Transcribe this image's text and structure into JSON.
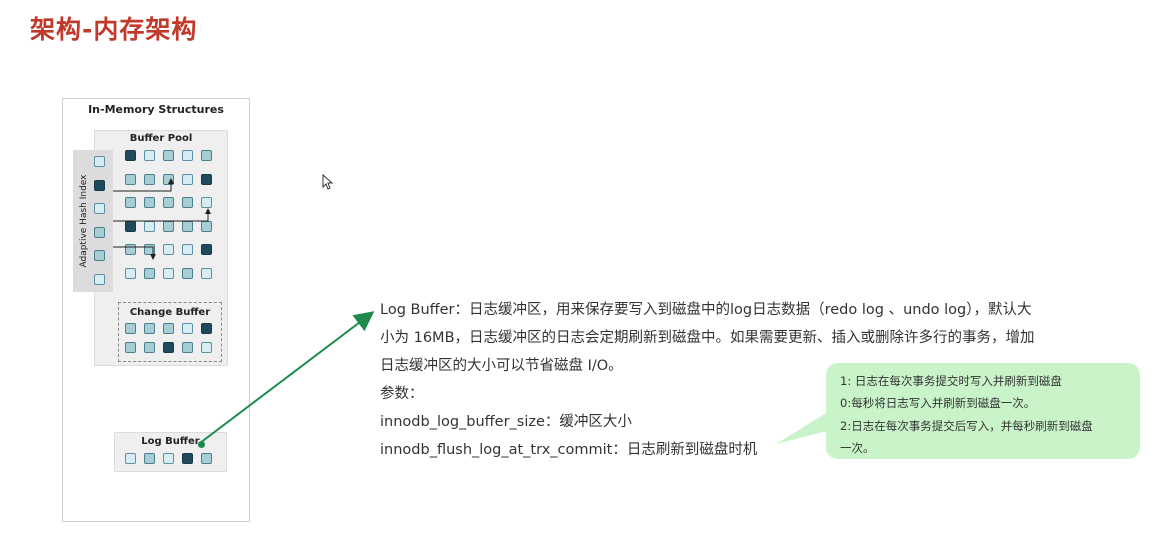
{
  "page": {
    "title": "架构-内存架构"
  },
  "diagram": {
    "title": "In-Memory Structures",
    "buffer_pool_title": "Buffer Pool",
    "adaptive_hash_index_label": "Adaptive Hash Index",
    "change_buffer_title": "Change Buffer",
    "log_buffer_title": "Log Buffer",
    "ahi_pages": [
      "light",
      "dark",
      "light",
      "mid",
      "mid",
      "light"
    ],
    "buffer_pool_rows": [
      [
        "dark",
        "light",
        "mid",
        "light",
        "mid"
      ],
      [
        "mid",
        "mid",
        "mid",
        "light",
        "dark"
      ],
      [
        "mid",
        "mid",
        "mid",
        "mid",
        "light"
      ],
      [
        "dark",
        "light",
        "mid",
        "mid",
        "mid"
      ],
      [
        "mid",
        "mid",
        "light",
        "light",
        "dark"
      ],
      [
        "light",
        "mid",
        "light",
        "mid",
        "light"
      ]
    ],
    "change_buffer_rows": [
      [
        "mid",
        "mid",
        "mid",
        "light",
        "dark"
      ],
      [
        "mid",
        "mid",
        "dark",
        "mid",
        "light"
      ]
    ],
    "log_buffer_pages": [
      "light",
      "mid",
      "light",
      "dark",
      "mid"
    ],
    "colors": {
      "light": "#d8ecf3",
      "mid": "#a7cdd5",
      "dark": "#1e4a5c",
      "arrow": "#1e8a4c",
      "title": "#c0392b"
    }
  },
  "description": {
    "line1": "Log Buffer：日志缓冲区，用来保存要写入到磁盘中的log日志数据（redo log 、undo log），默认大",
    "line2": "小为 16MB，日志缓冲区的日志会定期刷新到磁盘中。如果需要更新、插入或删除许多行的事务，增加",
    "line3": "日志缓冲区的大小可以节省磁盘 I/O。",
    "line4": "参数：",
    "line5": "innodb_log_buffer_size：缓冲区大小",
    "line6": "innodb_flush_log_at_trx_commit：日志刷新到磁盘时机"
  },
  "note": {
    "line1": "1: 日志在每次事务提交时写入并刷新到磁盘",
    "line2": "0:每秒将日志写入并刷新到磁盘一次。",
    "line3": "2:日志在每次事务提交后写入，并每秒刷新到磁盘",
    "line4": "一次。"
  }
}
